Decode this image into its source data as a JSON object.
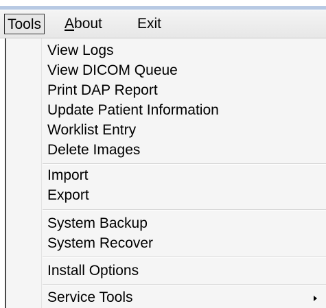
{
  "menubar": {
    "tools": "Tools",
    "about": {
      "mnemonic": "A",
      "rest": "bout"
    },
    "exit": "Exit"
  },
  "tools_menu": {
    "view_logs": "View Logs",
    "view_dicom_queue": "View DICOM Queue",
    "print_dap_report": "Print DAP Report",
    "update_patient_information": "Update Patient Information",
    "worklist_entry": "Worklist Entry",
    "delete_images": "Delete Images",
    "import": "Import",
    "export": "Export",
    "system_backup": "System Backup",
    "system_recover": "System Recover",
    "install_options": "Install Options",
    "service_tools": "Service Tools"
  },
  "icons": {
    "service_tools_submenu": "submenu-arrow-icon"
  }
}
